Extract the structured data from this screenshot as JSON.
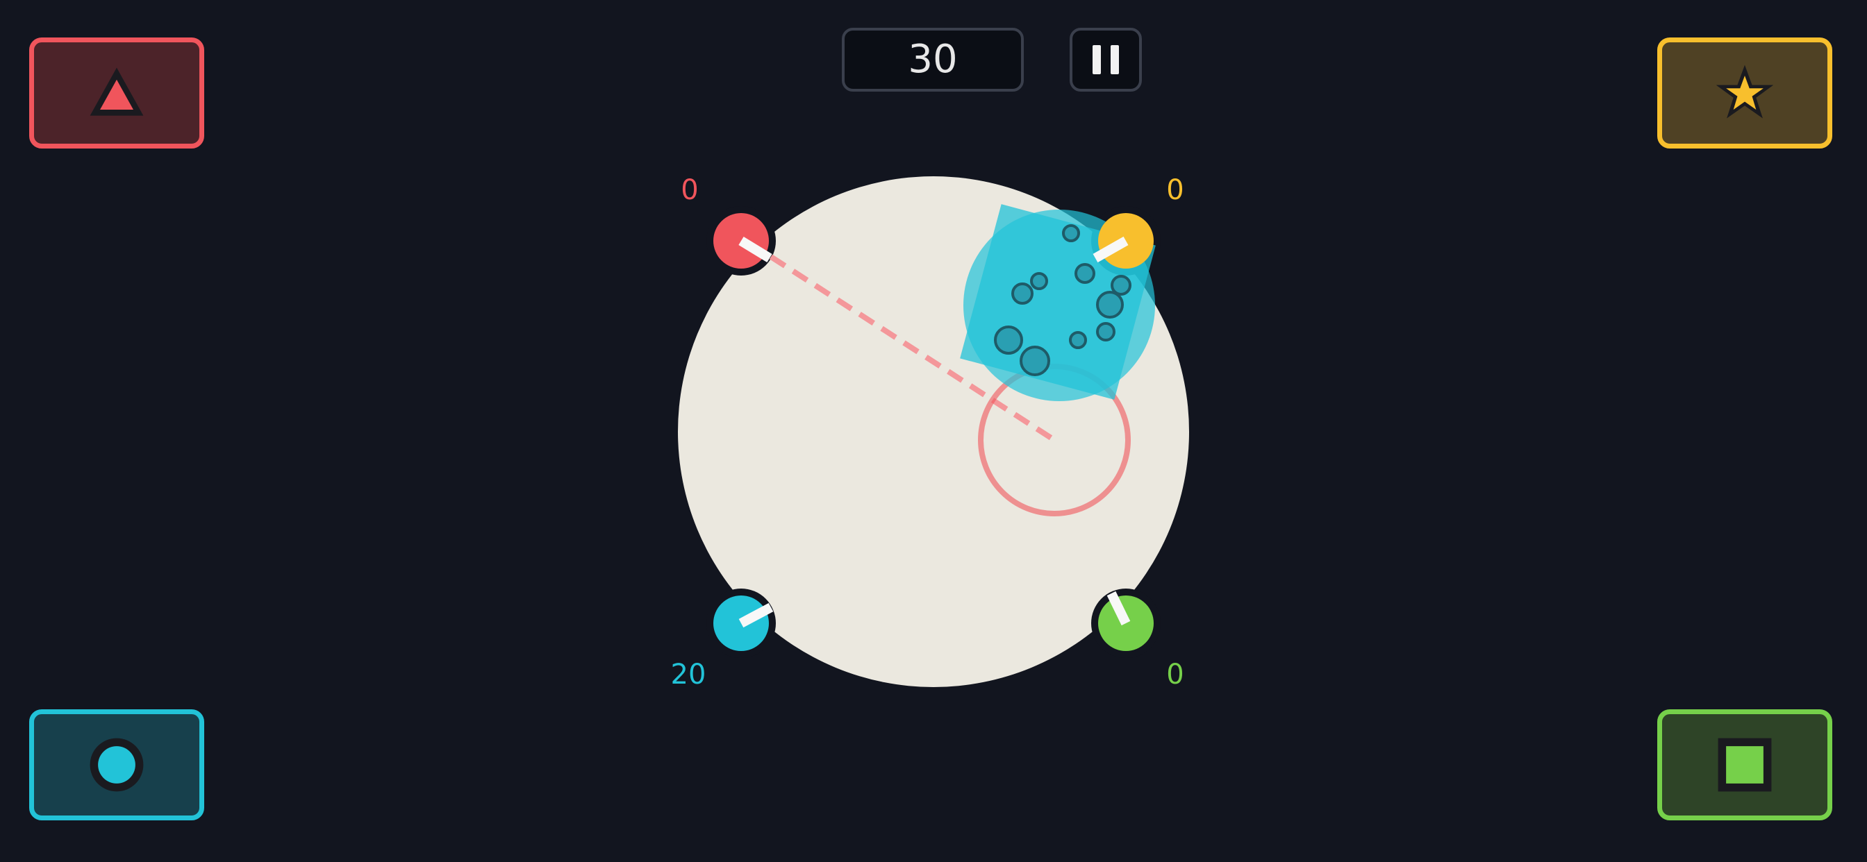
{
  "hud": {
    "timer": "30",
    "pause_icon": "pause-icon"
  },
  "players": [
    {
      "id": "red",
      "color": "#f0555c",
      "shape": "triangle-icon",
      "score": "0"
    },
    {
      "id": "yellow",
      "color": "#f8bf2d",
      "shape": "star-icon",
      "score": "0"
    },
    {
      "id": "cyan",
      "color": "#22c3d8",
      "shape": "circle-icon",
      "score": "20"
    },
    {
      "id": "green",
      "color": "#76d04a",
      "shape": "square-icon",
      "score": "0"
    }
  ],
  "arena": {
    "floor_color": "#ebe8df",
    "target_ring_color": "#f0555c"
  }
}
